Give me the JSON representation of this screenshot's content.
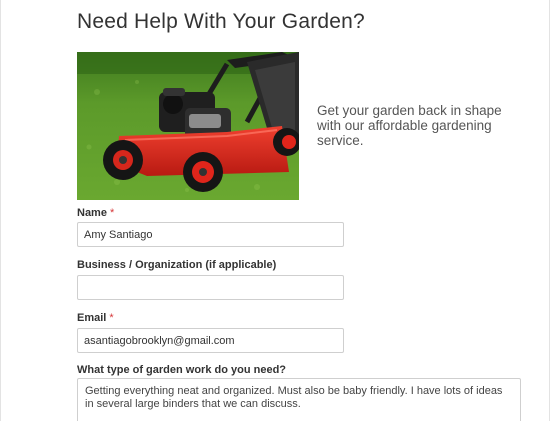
{
  "form": {
    "title": "Need Help With Your Garden?",
    "intro": "Get your garden back in shape with our affordable gardening service.",
    "image_subject": "red lawn mower on grass",
    "required_marker": "*",
    "colors": {
      "required": "#d63638",
      "grass": "#5c9a2a",
      "mower": "#e0251b"
    },
    "fields": {
      "name": {
        "label": "Name",
        "value": "Amy Santiago"
      },
      "business": {
        "label": "Business / Organization (if applicable)",
        "value": ""
      },
      "email": {
        "label": "Email",
        "value": "asantiagobrooklyn@gmail.com"
      },
      "work_type": {
        "label": "What type of garden work do you need?",
        "value": "Getting everything neat and organized. Must also be baby friendly. I have lots of ideas in several large binders that we can discuss."
      }
    }
  }
}
